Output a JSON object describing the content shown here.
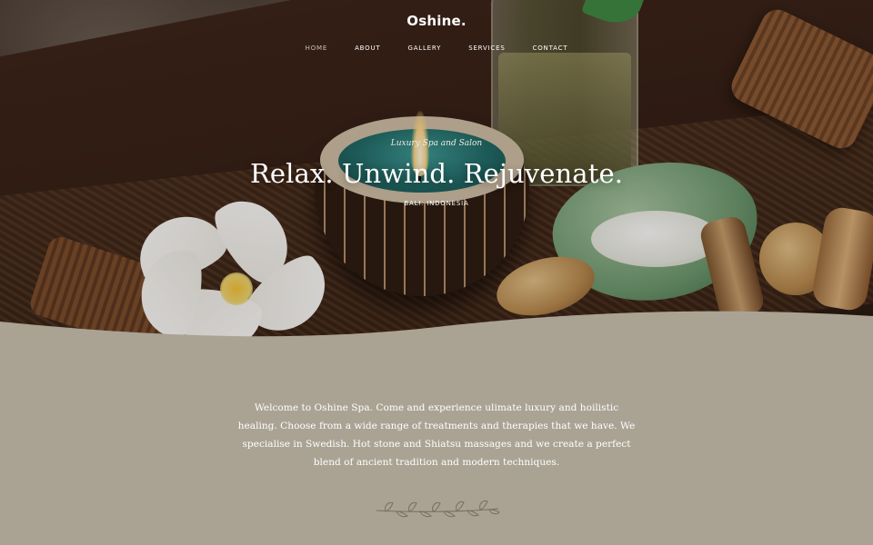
{
  "brand": {
    "name": "Oshine."
  },
  "nav": {
    "items": [
      {
        "label": "Home",
        "active": true
      },
      {
        "label": "About",
        "active": false
      },
      {
        "label": "Gallery",
        "active": false
      },
      {
        "label": "Services",
        "active": false
      },
      {
        "label": "Contact",
        "active": false
      }
    ]
  },
  "hero": {
    "tagline": "Luxury Spa and Salon",
    "title": "Relax. Unwind. Rejuvenate.",
    "location": "Bali. Indonesia"
  },
  "intro": {
    "text": "Welcome to Oshine Spa. Come and experience ulimate luxury and hoilistic healing. Choose from a wide range of treatments and therapies that we have. We specialise in Swedish. Hot stone and Shiatsu massages and we create a perfect blend of ancient tradition and modern techniques."
  },
  "divider": {
    "icon": "leaf-branch-icon"
  },
  "colors": {
    "content_background": "#aaa394",
    "text_light": "#ffffff",
    "nav_active": "#c9c3b4"
  }
}
